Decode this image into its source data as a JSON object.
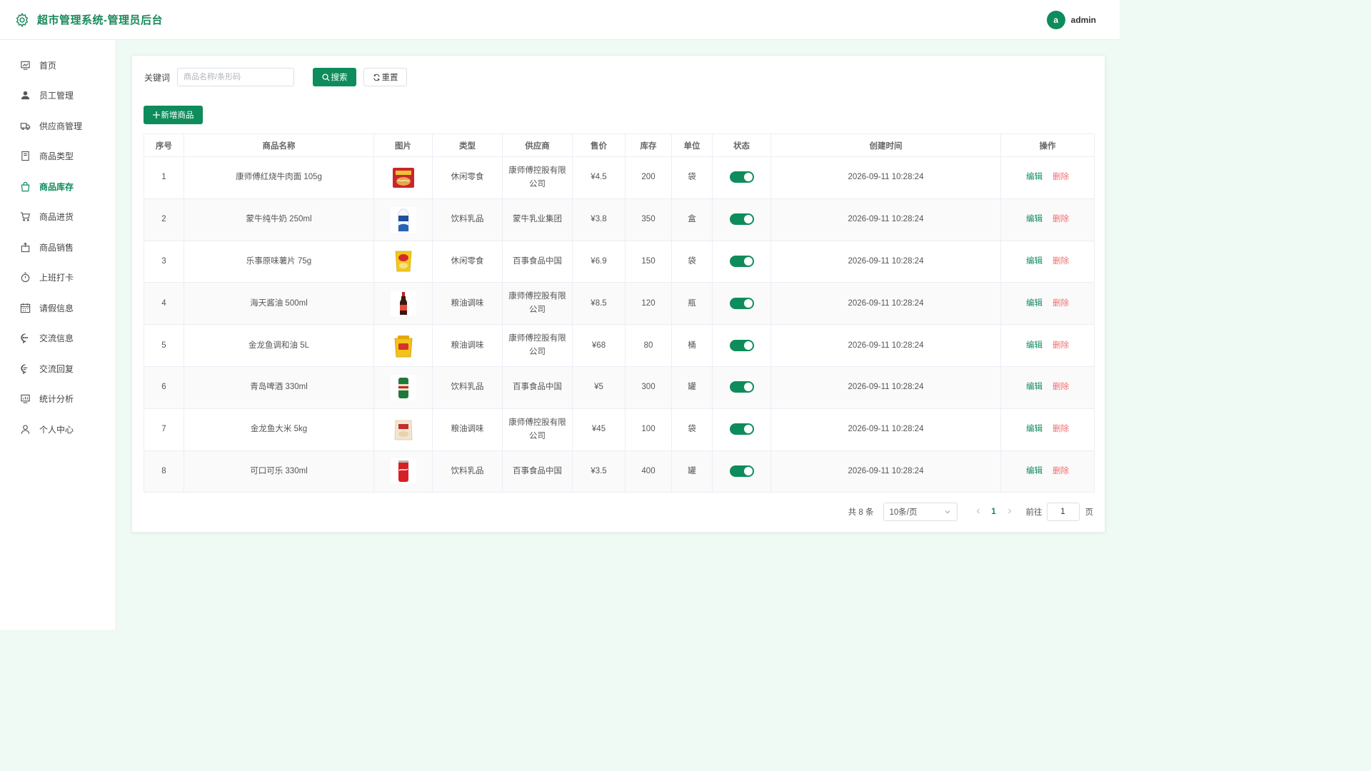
{
  "header": {
    "title": "超市管理系统-管理员后台",
    "avatar_letter": "a",
    "username": "admin",
    "brand_color": "#1a8a5a"
  },
  "sidebar": {
    "active": "商品库存",
    "items": [
      {
        "label": "首页",
        "icon": "dashboard-icon"
      },
      {
        "label": "员工管理",
        "icon": "user-icon"
      },
      {
        "label": "供应商管理",
        "icon": "truck-icon"
      },
      {
        "label": "商品类型",
        "icon": "notebook-icon"
      },
      {
        "label": "商品库存",
        "icon": "shopping-bag-icon"
      },
      {
        "label": "商品进货",
        "icon": "cart-icon"
      },
      {
        "label": "商品销售",
        "icon": "sell-icon"
      },
      {
        "label": "上班打卡",
        "icon": "stopwatch-icon"
      },
      {
        "label": "请假信息",
        "icon": "calendar-icon"
      },
      {
        "label": "交流信息",
        "icon": "chat-icon"
      },
      {
        "label": "交流回复",
        "icon": "chat-reply-icon"
      },
      {
        "label": "统计分析",
        "icon": "chart-icon"
      },
      {
        "label": "个人中心",
        "icon": "person-icon"
      }
    ]
  },
  "search": {
    "label": "关键词",
    "placeholder": "商品名称/条形码",
    "value": "",
    "search_button": "搜索",
    "reset_button": "重置"
  },
  "toolbar": {
    "add_button": "新增商品"
  },
  "table": {
    "columns": [
      "序号",
      "商品名称",
      "图片",
      "类型",
      "供应商",
      "售价",
      "库存",
      "单位",
      "状态",
      "创建时间",
      "操作"
    ],
    "edit_label": "编辑",
    "delete_label": "删除",
    "rows": [
      {
        "index": "1",
        "name": "康师傅红烧牛肉面 105g",
        "image": "noodle-cup-image",
        "category": "休闲零食",
        "supplier": "康师傅控股有限公司",
        "price": "¥4.5",
        "stock": "200",
        "unit": "袋",
        "status": true,
        "created": "2026-09-11 10:28:24"
      },
      {
        "index": "2",
        "name": "蒙牛纯牛奶 250ml",
        "image": "milk-carton-image",
        "category": "饮料乳品",
        "supplier": "蒙牛乳业集团",
        "price": "¥3.8",
        "stock": "350",
        "unit": "盒",
        "status": true,
        "created": "2026-09-11 10:28:24"
      },
      {
        "index": "3",
        "name": "乐事原味薯片 75g",
        "image": "chips-bag-image",
        "category": "休闲零食",
        "supplier": "百事食品中国",
        "price": "¥6.9",
        "stock": "150",
        "unit": "袋",
        "status": true,
        "created": "2026-09-11 10:28:24"
      },
      {
        "index": "4",
        "name": "海天酱油 500ml",
        "image": "soy-sauce-bottle-image",
        "category": "粮油调味",
        "supplier": "康师傅控股有限公司",
        "price": "¥8.5",
        "stock": "120",
        "unit": "瓶",
        "status": true,
        "created": "2026-09-11 10:28:24"
      },
      {
        "index": "5",
        "name": "金龙鱼调和油 5L",
        "image": "oil-bucket-image",
        "category": "粮油调味",
        "supplier": "康师傅控股有限公司",
        "price": "¥68",
        "stock": "80",
        "unit": "桶",
        "status": true,
        "created": "2026-09-11 10:28:24"
      },
      {
        "index": "6",
        "name": "青岛啤酒 330ml",
        "image": "beer-can-image",
        "category": "饮料乳品",
        "supplier": "百事食品中国",
        "price": "¥5",
        "stock": "300",
        "unit": "罐",
        "status": true,
        "created": "2026-09-11 10:28:24"
      },
      {
        "index": "7",
        "name": "金龙鱼大米 5kg",
        "image": "rice-bag-image",
        "category": "粮油调味",
        "supplier": "康师傅控股有限公司",
        "price": "¥45",
        "stock": "100",
        "unit": "袋",
        "status": true,
        "created": "2026-09-11 10:28:24"
      },
      {
        "index": "8",
        "name": "可口可乐 330ml",
        "image": "cola-can-image",
        "category": "饮料乳品",
        "supplier": "百事食品中国",
        "price": "¥3.5",
        "stock": "400",
        "unit": "罐",
        "status": true,
        "created": "2026-09-11 10:28:24"
      }
    ]
  },
  "pagination": {
    "total_text": "共 8 条",
    "page_size": "10条/页",
    "current_page": "1",
    "goto_label": "前往",
    "goto_value": "1",
    "goto_suffix": "页"
  },
  "colors": {
    "primary": "#0e8c5c",
    "danger": "#f56c6c",
    "background": "#f0faf4"
  }
}
